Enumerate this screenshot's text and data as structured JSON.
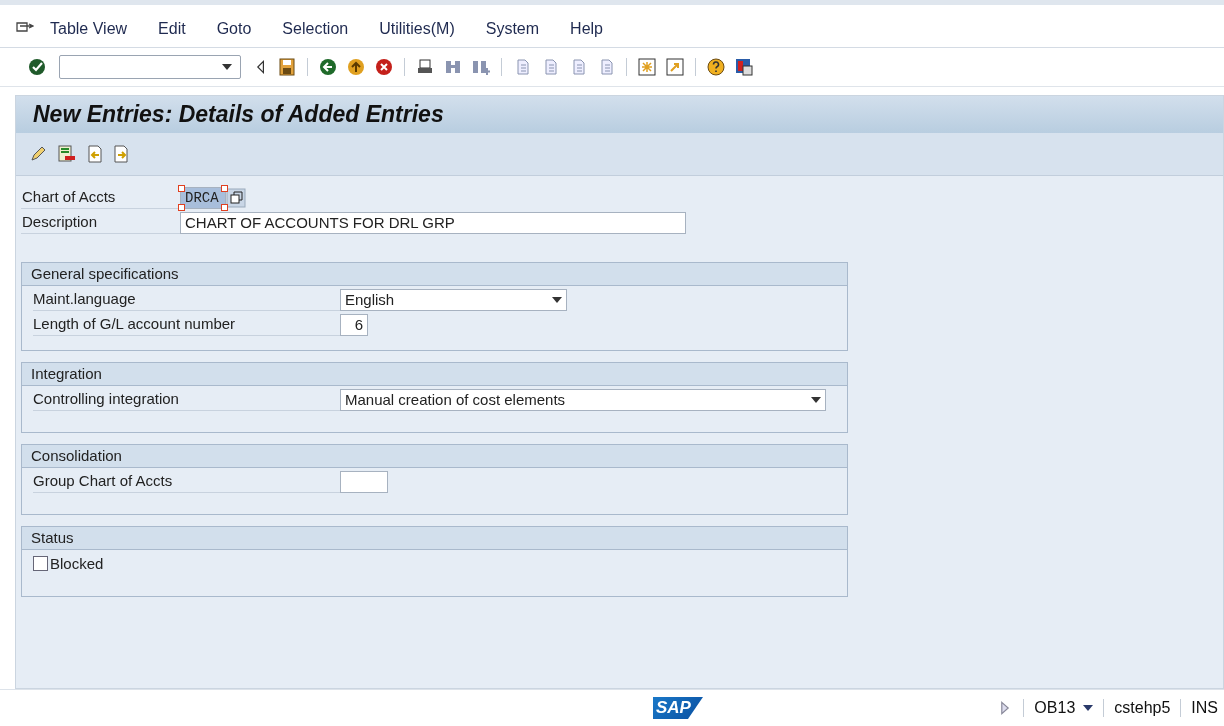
{
  "menu_bar": {
    "items": [
      "Table View",
      "Edit",
      "Goto",
      "Selection",
      "Utilities(M)",
      "System",
      "Help"
    ]
  },
  "screen_title": "New Entries: Details of Added Entries",
  "header_fields": [
    {
      "label": "Chart of Accts",
      "value": "DRCA",
      "highlighted": true
    },
    {
      "label": "Description",
      "value": "CHART OF ACCOUNTS FOR DRL GRP",
      "highlighted": false
    }
  ],
  "groups": [
    {
      "title": "General specifications",
      "rows": [
        {
          "kind": "dropdown",
          "label": "Maint.language",
          "value": "English"
        },
        {
          "kind": "input",
          "label": "Length of G/L account number",
          "value": "6"
        }
      ]
    },
    {
      "title": "Integration",
      "rows": [
        {
          "kind": "dropdown",
          "label": "Controlling integration",
          "value": "Manual creation of cost elements"
        }
      ]
    },
    {
      "title": "Consolidation",
      "rows": [
        {
          "kind": "input",
          "label": "Group Chart of Accts",
          "value": ""
        }
      ]
    },
    {
      "title": "Status",
      "rows": [
        {
          "kind": "checkbox",
          "label": "Blocked",
          "checked": false
        }
      ]
    }
  ],
  "status_bar": {
    "logo": "SAP",
    "transaction": "OB13",
    "system": "cstehp5",
    "mode": "INS"
  }
}
